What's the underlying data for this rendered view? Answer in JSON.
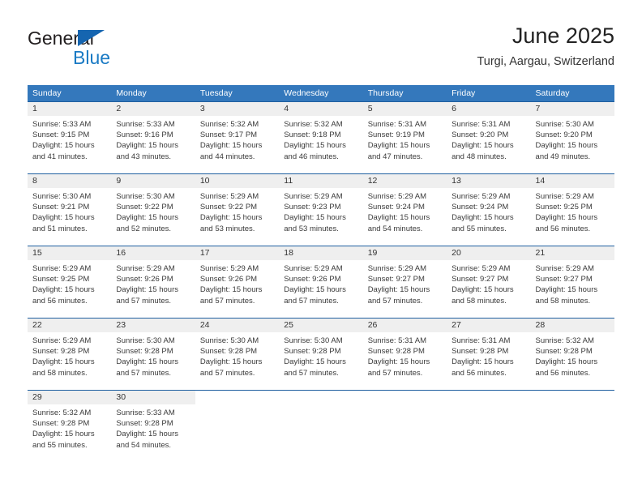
{
  "brand": {
    "name_part1": "General",
    "name_part2": "Blue",
    "triangle_color": "#1565b0",
    "blue_color": "#1a7ac4"
  },
  "header": {
    "title": "June 2025",
    "subtitle": "Turgi, Aargau, Switzerland"
  },
  "theme": {
    "header_bg": "#3478bc",
    "row_border": "#1f5fa0",
    "daynum_bg": "#efefef"
  },
  "weekdays": [
    "Sunday",
    "Monday",
    "Tuesday",
    "Wednesday",
    "Thursday",
    "Friday",
    "Saturday"
  ],
  "weeks": [
    [
      {
        "day": "1",
        "sunrise": "Sunrise: 5:33 AM",
        "sunset": "Sunset: 9:15 PM",
        "daylight1": "Daylight: 15 hours",
        "daylight2": "and 41 minutes."
      },
      {
        "day": "2",
        "sunrise": "Sunrise: 5:33 AM",
        "sunset": "Sunset: 9:16 PM",
        "daylight1": "Daylight: 15 hours",
        "daylight2": "and 43 minutes."
      },
      {
        "day": "3",
        "sunrise": "Sunrise: 5:32 AM",
        "sunset": "Sunset: 9:17 PM",
        "daylight1": "Daylight: 15 hours",
        "daylight2": "and 44 minutes."
      },
      {
        "day": "4",
        "sunrise": "Sunrise: 5:32 AM",
        "sunset": "Sunset: 9:18 PM",
        "daylight1": "Daylight: 15 hours",
        "daylight2": "and 46 minutes."
      },
      {
        "day": "5",
        "sunrise": "Sunrise: 5:31 AM",
        "sunset": "Sunset: 9:19 PM",
        "daylight1": "Daylight: 15 hours",
        "daylight2": "and 47 minutes."
      },
      {
        "day": "6",
        "sunrise": "Sunrise: 5:31 AM",
        "sunset": "Sunset: 9:20 PM",
        "daylight1": "Daylight: 15 hours",
        "daylight2": "and 48 minutes."
      },
      {
        "day": "7",
        "sunrise": "Sunrise: 5:30 AM",
        "sunset": "Sunset: 9:20 PM",
        "daylight1": "Daylight: 15 hours",
        "daylight2": "and 49 minutes."
      }
    ],
    [
      {
        "day": "8",
        "sunrise": "Sunrise: 5:30 AM",
        "sunset": "Sunset: 9:21 PM",
        "daylight1": "Daylight: 15 hours",
        "daylight2": "and 51 minutes."
      },
      {
        "day": "9",
        "sunrise": "Sunrise: 5:30 AM",
        "sunset": "Sunset: 9:22 PM",
        "daylight1": "Daylight: 15 hours",
        "daylight2": "and 52 minutes."
      },
      {
        "day": "10",
        "sunrise": "Sunrise: 5:29 AM",
        "sunset": "Sunset: 9:22 PM",
        "daylight1": "Daylight: 15 hours",
        "daylight2": "and 53 minutes."
      },
      {
        "day": "11",
        "sunrise": "Sunrise: 5:29 AM",
        "sunset": "Sunset: 9:23 PM",
        "daylight1": "Daylight: 15 hours",
        "daylight2": "and 53 minutes."
      },
      {
        "day": "12",
        "sunrise": "Sunrise: 5:29 AM",
        "sunset": "Sunset: 9:24 PM",
        "daylight1": "Daylight: 15 hours",
        "daylight2": "and 54 minutes."
      },
      {
        "day": "13",
        "sunrise": "Sunrise: 5:29 AM",
        "sunset": "Sunset: 9:24 PM",
        "daylight1": "Daylight: 15 hours",
        "daylight2": "and 55 minutes."
      },
      {
        "day": "14",
        "sunrise": "Sunrise: 5:29 AM",
        "sunset": "Sunset: 9:25 PM",
        "daylight1": "Daylight: 15 hours",
        "daylight2": "and 56 minutes."
      }
    ],
    [
      {
        "day": "15",
        "sunrise": "Sunrise: 5:29 AM",
        "sunset": "Sunset: 9:25 PM",
        "daylight1": "Daylight: 15 hours",
        "daylight2": "and 56 minutes."
      },
      {
        "day": "16",
        "sunrise": "Sunrise: 5:29 AM",
        "sunset": "Sunset: 9:26 PM",
        "daylight1": "Daylight: 15 hours",
        "daylight2": "and 57 minutes."
      },
      {
        "day": "17",
        "sunrise": "Sunrise: 5:29 AM",
        "sunset": "Sunset: 9:26 PM",
        "daylight1": "Daylight: 15 hours",
        "daylight2": "and 57 minutes."
      },
      {
        "day": "18",
        "sunrise": "Sunrise: 5:29 AM",
        "sunset": "Sunset: 9:26 PM",
        "daylight1": "Daylight: 15 hours",
        "daylight2": "and 57 minutes."
      },
      {
        "day": "19",
        "sunrise": "Sunrise: 5:29 AM",
        "sunset": "Sunset: 9:27 PM",
        "daylight1": "Daylight: 15 hours",
        "daylight2": "and 57 minutes."
      },
      {
        "day": "20",
        "sunrise": "Sunrise: 5:29 AM",
        "sunset": "Sunset: 9:27 PM",
        "daylight1": "Daylight: 15 hours",
        "daylight2": "and 58 minutes."
      },
      {
        "day": "21",
        "sunrise": "Sunrise: 5:29 AM",
        "sunset": "Sunset: 9:27 PM",
        "daylight1": "Daylight: 15 hours",
        "daylight2": "and 58 minutes."
      }
    ],
    [
      {
        "day": "22",
        "sunrise": "Sunrise: 5:29 AM",
        "sunset": "Sunset: 9:28 PM",
        "daylight1": "Daylight: 15 hours",
        "daylight2": "and 58 minutes."
      },
      {
        "day": "23",
        "sunrise": "Sunrise: 5:30 AM",
        "sunset": "Sunset: 9:28 PM",
        "daylight1": "Daylight: 15 hours",
        "daylight2": "and 57 minutes."
      },
      {
        "day": "24",
        "sunrise": "Sunrise: 5:30 AM",
        "sunset": "Sunset: 9:28 PM",
        "daylight1": "Daylight: 15 hours",
        "daylight2": "and 57 minutes."
      },
      {
        "day": "25",
        "sunrise": "Sunrise: 5:30 AM",
        "sunset": "Sunset: 9:28 PM",
        "daylight1": "Daylight: 15 hours",
        "daylight2": "and 57 minutes."
      },
      {
        "day": "26",
        "sunrise": "Sunrise: 5:31 AM",
        "sunset": "Sunset: 9:28 PM",
        "daylight1": "Daylight: 15 hours",
        "daylight2": "and 57 minutes."
      },
      {
        "day": "27",
        "sunrise": "Sunrise: 5:31 AM",
        "sunset": "Sunset: 9:28 PM",
        "daylight1": "Daylight: 15 hours",
        "daylight2": "and 56 minutes."
      },
      {
        "day": "28",
        "sunrise": "Sunrise: 5:32 AM",
        "sunset": "Sunset: 9:28 PM",
        "daylight1": "Daylight: 15 hours",
        "daylight2": "and 56 minutes."
      }
    ],
    [
      {
        "day": "29",
        "sunrise": "Sunrise: 5:32 AM",
        "sunset": "Sunset: 9:28 PM",
        "daylight1": "Daylight: 15 hours",
        "daylight2": "and 55 minutes."
      },
      {
        "day": "30",
        "sunrise": "Sunrise: 5:33 AM",
        "sunset": "Sunset: 9:28 PM",
        "daylight1": "Daylight: 15 hours",
        "daylight2": "and 54 minutes."
      },
      {
        "day": "",
        "sunrise": "",
        "sunset": "",
        "daylight1": "",
        "daylight2": ""
      },
      {
        "day": "",
        "sunrise": "",
        "sunset": "",
        "daylight1": "",
        "daylight2": ""
      },
      {
        "day": "",
        "sunrise": "",
        "sunset": "",
        "daylight1": "",
        "daylight2": ""
      },
      {
        "day": "",
        "sunrise": "",
        "sunset": "",
        "daylight1": "",
        "daylight2": ""
      },
      {
        "day": "",
        "sunrise": "",
        "sunset": "",
        "daylight1": "",
        "daylight2": ""
      }
    ]
  ]
}
